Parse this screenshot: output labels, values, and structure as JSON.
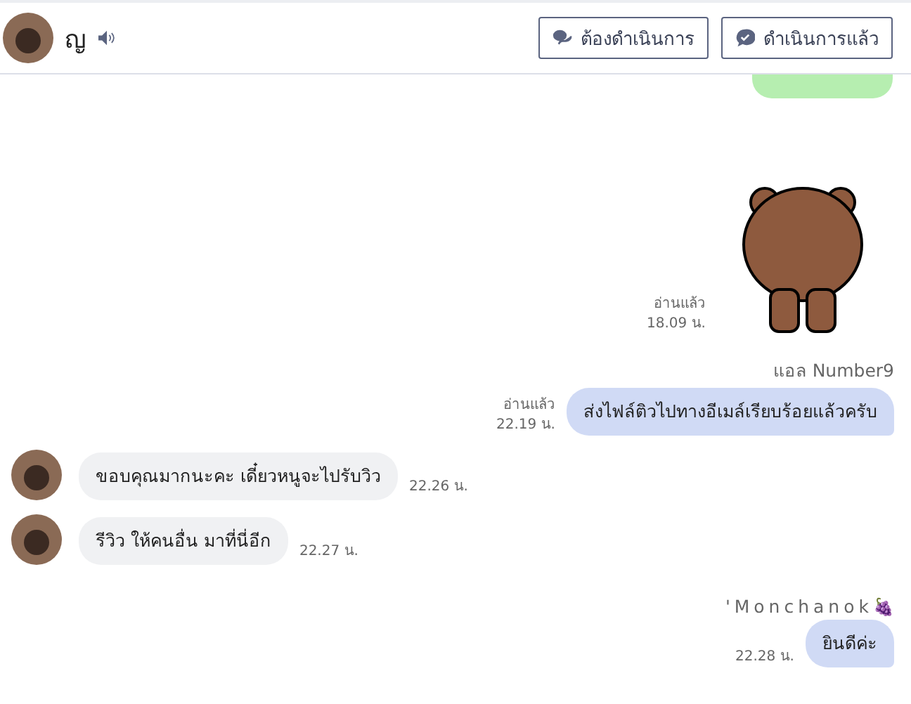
{
  "header": {
    "contact_name": "ญ",
    "buttons": [
      {
        "label": "ต้องดำเนินการ",
        "kind": "todo"
      },
      {
        "label": "ดำเนินการแล้ว",
        "kind": "done"
      }
    ]
  },
  "messages": [
    {
      "kind": "partial_out"
    },
    {
      "kind": "sticker_out",
      "read": "อ่านแล้ว",
      "time": "18.09 น."
    },
    {
      "kind": "text_out",
      "sender": "แอล Number9",
      "text": "ส่งไฟล์ติวไปทางอีเมล์เรียบร้อยแล้วครับ",
      "read": "อ่านแล้ว",
      "time": "22.19 น."
    },
    {
      "kind": "text_in",
      "text": "ขอบคุณมากนะคะ เดี๋ยวหนูจะไปรับวิว",
      "time": "22.26 น."
    },
    {
      "kind": "text_in",
      "text": "รีวิว ให้คนอื่น มาที่นี่อีก",
      "time": "22.27 น."
    },
    {
      "kind": "text_out",
      "sender": "'Monchanok",
      "sender_emoji": "🍇",
      "text": "ยินดีค่ะ",
      "time": "22.28 น."
    }
  ]
}
